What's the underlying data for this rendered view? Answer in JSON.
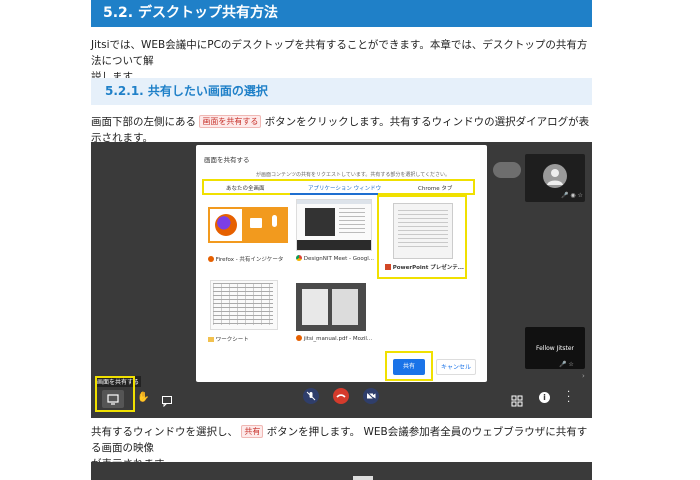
{
  "section": {
    "title": "5.2. デスクトップ共有方法",
    "intro_line1": "Jitsiでは、WEB会議中にPCのデスクトップを共有することができます。本章では、デスクトップの共有方法について解",
    "intro_line2": "説します。"
  },
  "subsection": {
    "title": "5.2.1. 共有したい画面の選択",
    "para_prefix": "画面下部の左側にある",
    "para_button": "画面を共有する",
    "para_suffix": "ボタンをクリックします。共有するウィンドウの選択ダイアログが表示されます。"
  },
  "dialog": {
    "title": "画面を共有する",
    "subtitle": "が画面コンテンツの共有をリクエストしています。共有する部分を選択してください。",
    "tabs": [
      "あなたの全画面",
      "アプリケーション ウィンドウ",
      "Chrome タブ"
    ],
    "active_tab": 1,
    "windows": [
      {
        "caption": "Firefox - 共有インジケータ"
      },
      {
        "caption": "DesignNIT Meet - Googl..."
      },
      {
        "caption": "PowerPoint プレゼンテ..."
      },
      {
        "caption": "ワークシート"
      },
      {
        "caption": "jitsi_manual.pdf - Mozil..."
      }
    ],
    "share_label": "共有",
    "cancel_label": "キャンセル"
  },
  "meeting": {
    "participant_label": "Fellow Jitster",
    "share_tooltip": "画面を共有する",
    "accent": "#f0e000"
  },
  "after": {
    "line1_prefix": "共有するウィンドウを選択し、",
    "line1_button": "共有",
    "line1_suffix": "ボタンを押します。 WEB会議参加者全員のウェブブラウザに共有する画面の映像",
    "line2": "が表示されます。"
  }
}
